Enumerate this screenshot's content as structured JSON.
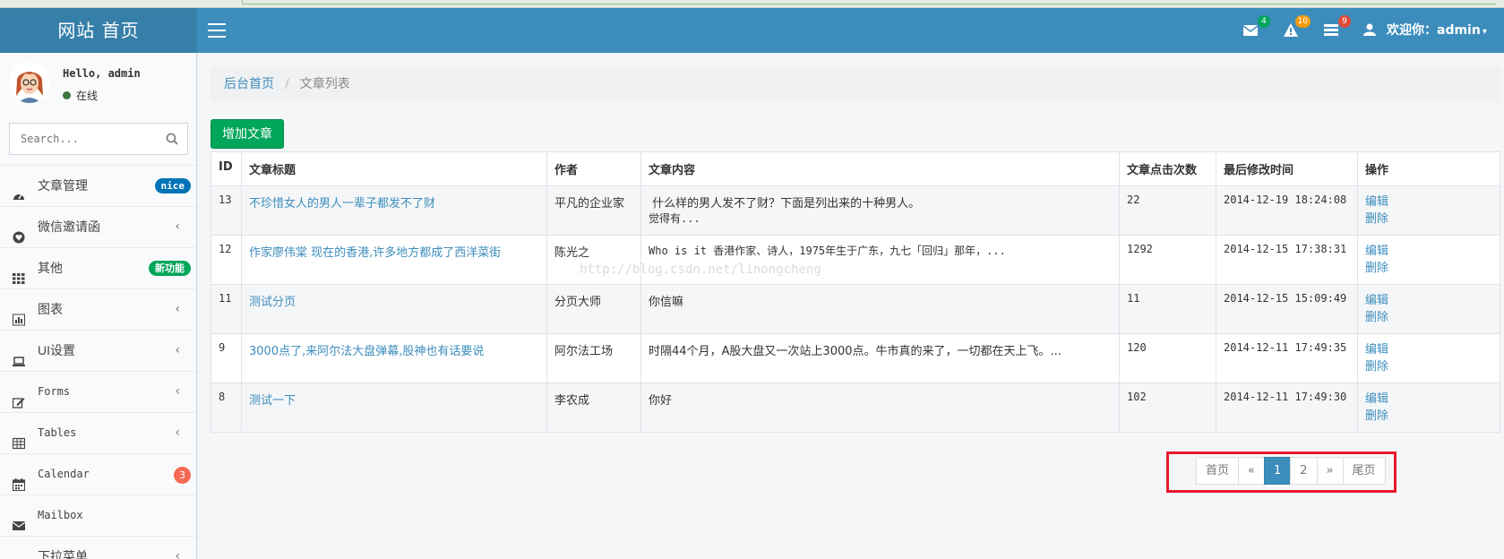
{
  "header": {
    "logo": "网站 首页",
    "badges": {
      "messages": "4",
      "alerts": "10",
      "tasks": "9"
    },
    "user_label": "欢迎你：admin"
  },
  "sidebar": {
    "hello": "Hello, admin",
    "status": "在线",
    "search_placeholder": "Search...",
    "items": [
      {
        "label": "文章管理",
        "badge": "nice"
      },
      {
        "label": "微信邀请函"
      },
      {
        "label": "其他",
        "badge": "新功能"
      },
      {
        "label": "图表"
      },
      {
        "label": "UI设置"
      },
      {
        "label": "Forms"
      },
      {
        "label": "Tables"
      },
      {
        "label": "Calendar",
        "badge": "3"
      },
      {
        "label": "Mailbox"
      },
      {
        "label": "下拉菜单"
      }
    ]
  },
  "breadcrumb": {
    "home": "后台首页",
    "current": "文章列表"
  },
  "add_button": "增加文章",
  "table": {
    "headers": [
      "ID",
      "文章标题",
      "作者",
      "文章内容",
      "文章点击次数",
      "最后修改时间",
      "操作"
    ],
    "rows": [
      {
        "id": "13",
        "title": "不珍惜女人的男人一辈子都发不了财",
        "author": "平凡的企业家",
        "content1": " 什么样的男人发不了财？下面是列出来的十种男人。",
        "content2": "觉得有...",
        "clicks": "22",
        "time": "2014-12-19 18:24:08",
        "edit": "编辑",
        "del": "删除"
      },
      {
        "id": "12",
        "title": "作家廖伟棠 现在的香港,许多地方都成了西洋菜街",
        "author": "陈光之",
        "content1": "Who is it 香港作家、诗人，1975年生于广东，九七「回归」那年，...",
        "content2": "",
        "clicks": "1292",
        "time": "2014-12-15 17:38:31",
        "edit": "编辑",
        "del": "删除"
      },
      {
        "id": "11",
        "title": "测试分页",
        "author": "分页大师",
        "content1": "你信嘛",
        "content2": "",
        "clicks": "11",
        "time": "2014-12-15 15:09:49",
        "edit": "编辑",
        "del": "删除"
      },
      {
        "id": "9",
        "title": "3000点了,来阿尔法大盘弹幕,股神也有话要说",
        "author": "阿尔法工场",
        "content1": "时隔44个月，A股大盘又一次站上3000点。牛市真的来了，一切都在天上飞。...",
        "content2": "",
        "clicks": "120",
        "time": "2014-12-11 17:49:35",
        "edit": "编辑",
        "del": "删除"
      },
      {
        "id": "8",
        "title": "测试一下",
        "author": "李农成",
        "content1": "你好",
        "content2": "",
        "clicks": "102",
        "time": "2014-12-11 17:49:30",
        "edit": "编辑",
        "del": "删除"
      }
    ]
  },
  "watermark": "http://blog.csdn.net/linongcheng",
  "pagination": {
    "first": "首页",
    "prev": "«",
    "page1": "1",
    "page2": "2",
    "next": "»",
    "last": "尾页"
  },
  "colors": {
    "header": "#3c8dbc",
    "logo_bg": "#367fa9",
    "success": "#00a65a",
    "highlight": "#e8192c"
  }
}
